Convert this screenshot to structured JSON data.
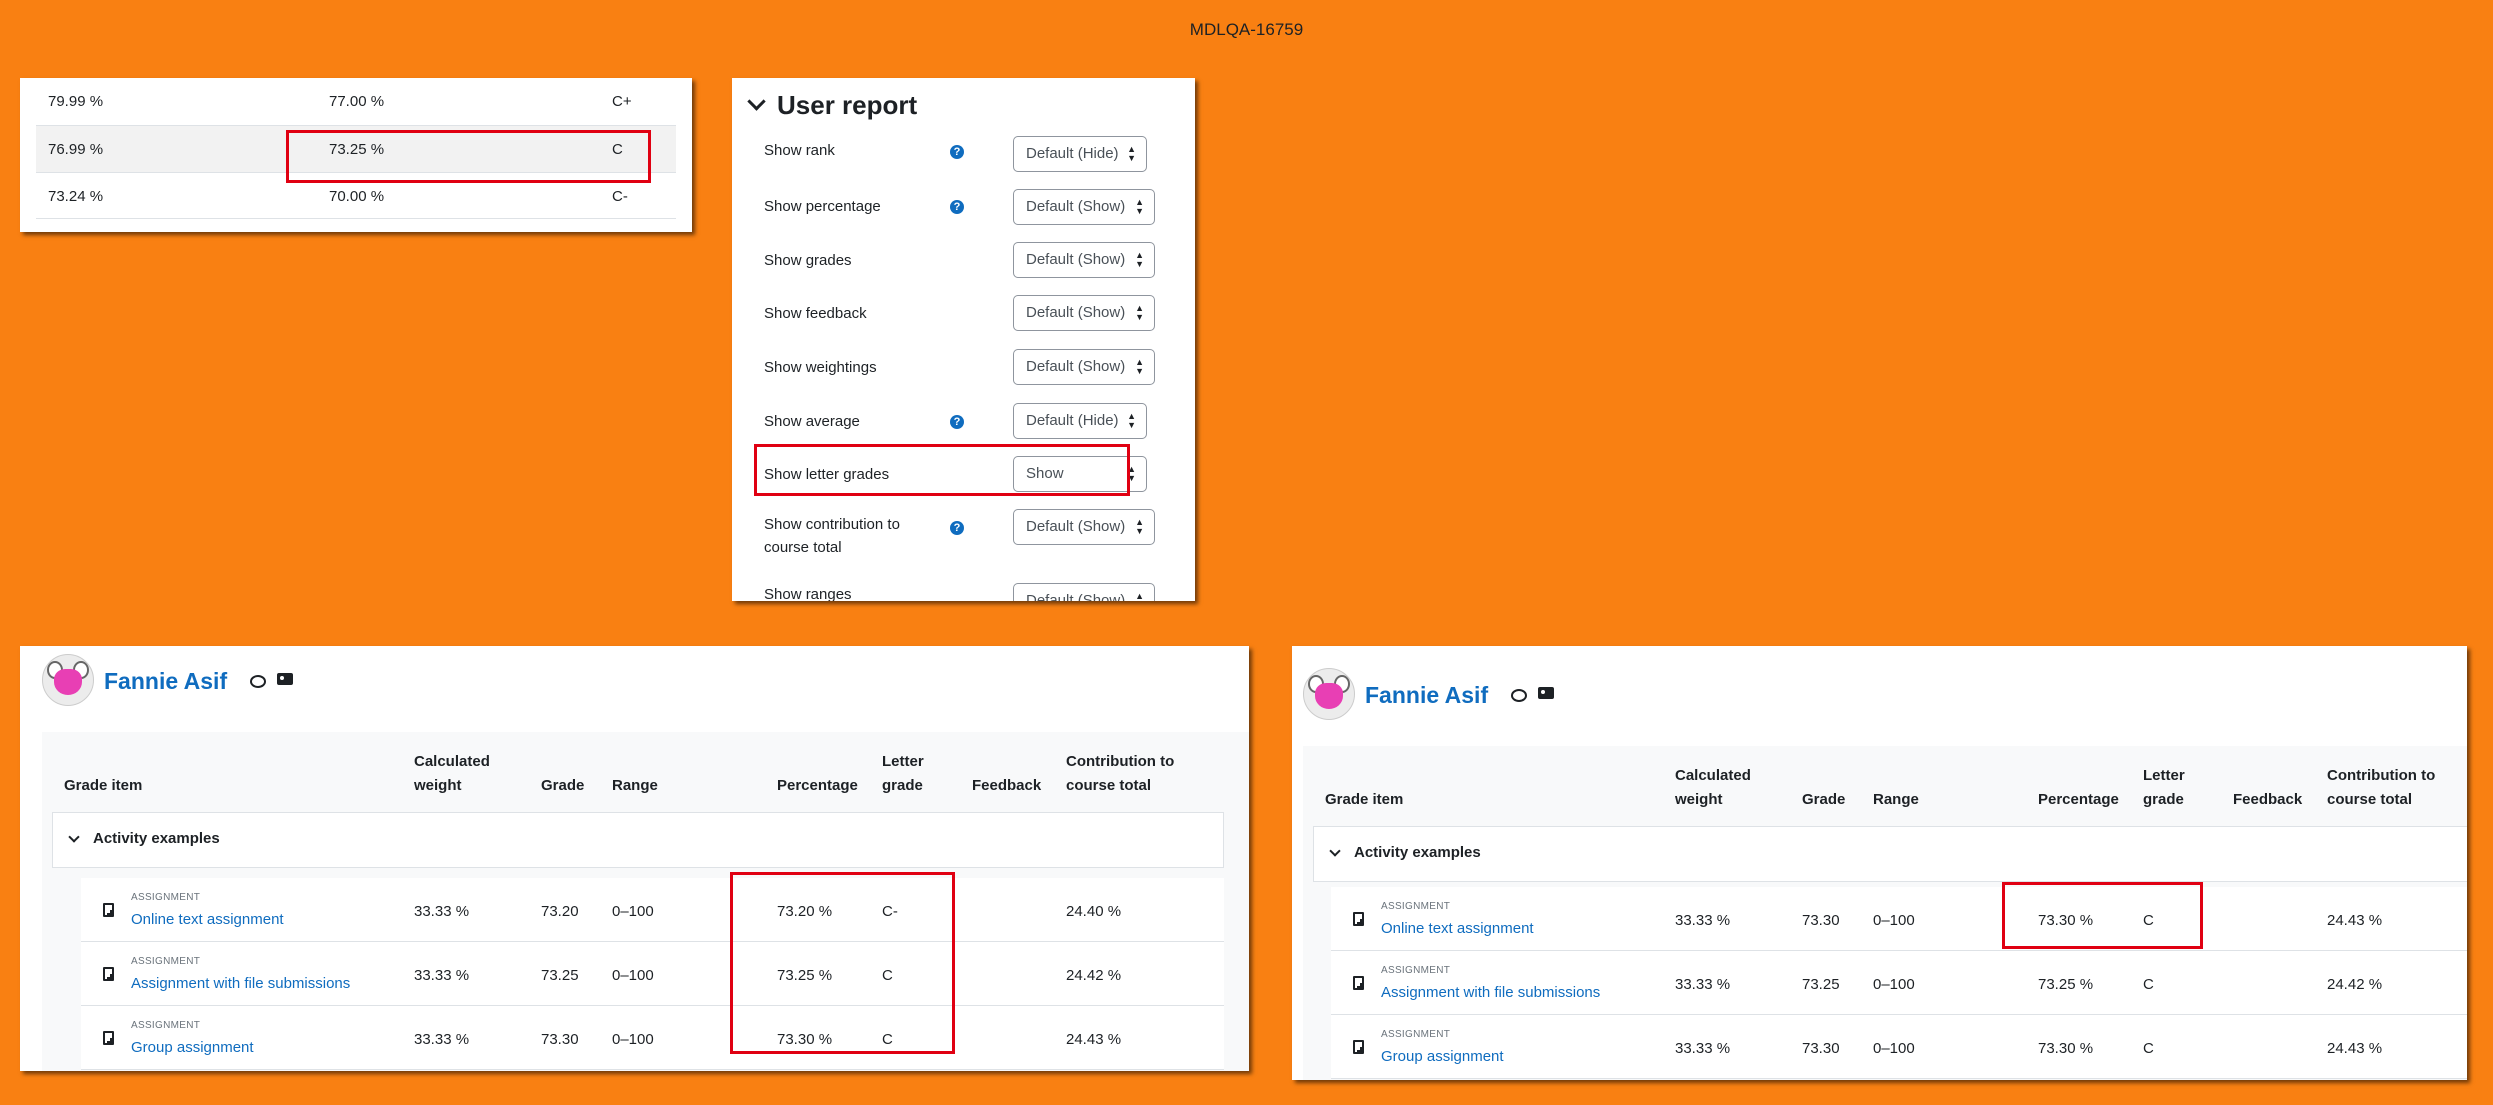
{
  "header": {
    "ticket": "MDLQA-16759"
  },
  "letters_table": {
    "rows": [
      {
        "max": "79.99 %",
        "min": "77.00 %",
        "letter": "C+"
      },
      {
        "max": "76.99 %",
        "min": "73.25 %",
        "letter": "C"
      },
      {
        "max": "73.24 %",
        "min": "70.00 %",
        "letter": "C-"
      }
    ]
  },
  "settings": {
    "heading": "User report",
    "rows": [
      {
        "label": "Show rank",
        "help": true,
        "value": "Default (Hide)"
      },
      {
        "label": "Show percentage",
        "help": true,
        "value": "Default (Show)"
      },
      {
        "label": "Show grades",
        "help": false,
        "value": "Default (Show)"
      },
      {
        "label": "Show feedback",
        "help": false,
        "value": "Default (Show)"
      },
      {
        "label": "Show weightings",
        "help": false,
        "value": "Default (Show)"
      },
      {
        "label": "Show average",
        "help": true,
        "value": "Default (Hide)"
      },
      {
        "label": "Show letter grades",
        "help": false,
        "value": "Show"
      },
      {
        "label": "Show contribution to course total",
        "help": true,
        "value": "Default (Show)"
      },
      {
        "label": "Show ranges",
        "help": false,
        "value": "Default (Show)"
      }
    ]
  },
  "reports": [
    {
      "user": "Fannie Asif",
      "headers": {
        "item": "Grade item",
        "weight": "Calculated weight",
        "grade": "Grade",
        "range": "Range",
        "percentage": "Percentage",
        "letter": "Letter grade",
        "feedback": "Feedback",
        "contribution": "Contribution to course total"
      },
      "category": "Activity examples",
      "rows": [
        {
          "kind": "ASSIGNMENT",
          "name": "Online text assignment",
          "weight": "33.33 %",
          "grade": "73.20",
          "range": "0–100",
          "percentage": "73.20 %",
          "letter": "C-",
          "contribution": "24.40 %"
        },
        {
          "kind": "ASSIGNMENT",
          "name": "Assignment with file submissions",
          "weight": "33.33 %",
          "grade": "73.25",
          "range": "0–100",
          "percentage": "73.25 %",
          "letter": "C",
          "contribution": "24.42 %"
        },
        {
          "kind": "ASSIGNMENT",
          "name": "Group assignment",
          "weight": "33.33 %",
          "grade": "73.30",
          "range": "0–100",
          "percentage": "73.30 %",
          "letter": "C",
          "contribution": "24.43 %"
        }
      ]
    },
    {
      "user": "Fannie Asif",
      "headers": {
        "item": "Grade item",
        "weight": "Calculated weight",
        "grade": "Grade",
        "range": "Range",
        "percentage": "Percentage",
        "letter": "Letter grade",
        "feedback": "Feedback",
        "contribution": "Contribution to course total"
      },
      "category": "Activity examples",
      "rows": [
        {
          "kind": "ASSIGNMENT",
          "name": "Online text assignment",
          "weight": "33.33 %",
          "grade": "73.30",
          "range": "0–100",
          "percentage": "73.30 %",
          "letter": "C",
          "contribution": "24.43 %"
        },
        {
          "kind": "ASSIGNMENT",
          "name": "Assignment with file submissions",
          "weight": "33.33 %",
          "grade": "73.25",
          "range": "0–100",
          "percentage": "73.25 %",
          "letter": "C",
          "contribution": "24.42 %"
        },
        {
          "kind": "ASSIGNMENT",
          "name": "Group assignment",
          "weight": "33.33 %",
          "grade": "73.30",
          "range": "0–100",
          "percentage": "73.30 %",
          "letter": "C",
          "contribution": "24.43 %"
        }
      ]
    }
  ],
  "colors": {
    "background": "#f98012",
    "highlight": "#e00012",
    "link": "#0f6cbf"
  }
}
